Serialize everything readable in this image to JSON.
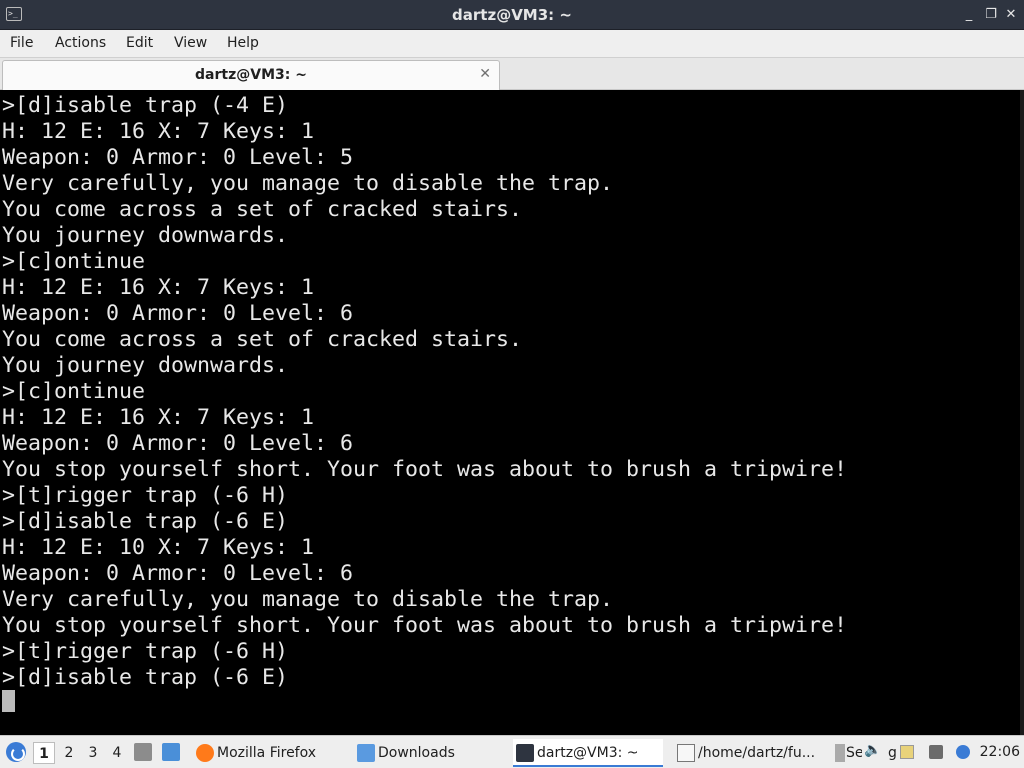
{
  "window": {
    "title": "dartz@VM3: ~",
    "controls": {
      "minimize": "_",
      "maximize": "❐",
      "close": "✕"
    }
  },
  "menu": [
    "File",
    "Actions",
    "Edit",
    "View",
    "Help"
  ],
  "tab": {
    "label": "dartz@VM3: ~",
    "close": "✕"
  },
  "terminal": {
    "lines": [
      ">[d]isable trap (-4 E)",
      "H: 12 E: 16 X: 7 Keys: 1",
      "Weapon: 0 Armor: 0 Level: 5",
      "Very carefully, you manage to disable the trap.",
      "You come across a set of cracked stairs.",
      "You journey downwards.",
      ">[c]ontinue",
      "H: 12 E: 16 X: 7 Keys: 1",
      "Weapon: 0 Armor: 0 Level: 6",
      "You come across a set of cracked stairs.",
      "You journey downwards.",
      ">[c]ontinue",
      "H: 12 E: 16 X: 7 Keys: 1",
      "Weapon: 0 Armor: 0 Level: 6",
      "You stop yourself short. Your foot was about to brush a tripwire!",
      ">[t]rigger trap (-6 H)",
      ">[d]isable trap (-6 E)",
      "H: 12 E: 10 X: 7 Keys: 1",
      "Weapon: 0 Armor: 0 Level: 6",
      "Very carefully, you manage to disable the trap.",
      "You stop yourself short. Your foot was about to brush a tripwire!",
      ">[t]rigger trap (-6 H)",
      ">[d]isable trap (-6 E)"
    ]
  },
  "taskbar": {
    "workspaces": [
      "1",
      "2",
      "3",
      "4"
    ],
    "tasks": [
      {
        "label": "Mozilla Firefox",
        "icon": "firefox-icon"
      },
      {
        "label": "Downloads",
        "icon": "folder-icon"
      },
      {
        "label": "dartz@VM3: ~",
        "icon": "terminal-icon"
      },
      {
        "label": "/home/dartz/fu...",
        "icon": "document-icon"
      },
      {
        "label": "Se",
        "icon": "app-icon"
      },
      {
        "label": "g",
        "icon": "app-icon"
      }
    ],
    "clock": "22:06"
  },
  "colors": {
    "titlebar": "#2e3440",
    "terminal_bg": "#000000",
    "terminal_fg": "#e8e8e8",
    "accent": "#3a7bd5"
  }
}
